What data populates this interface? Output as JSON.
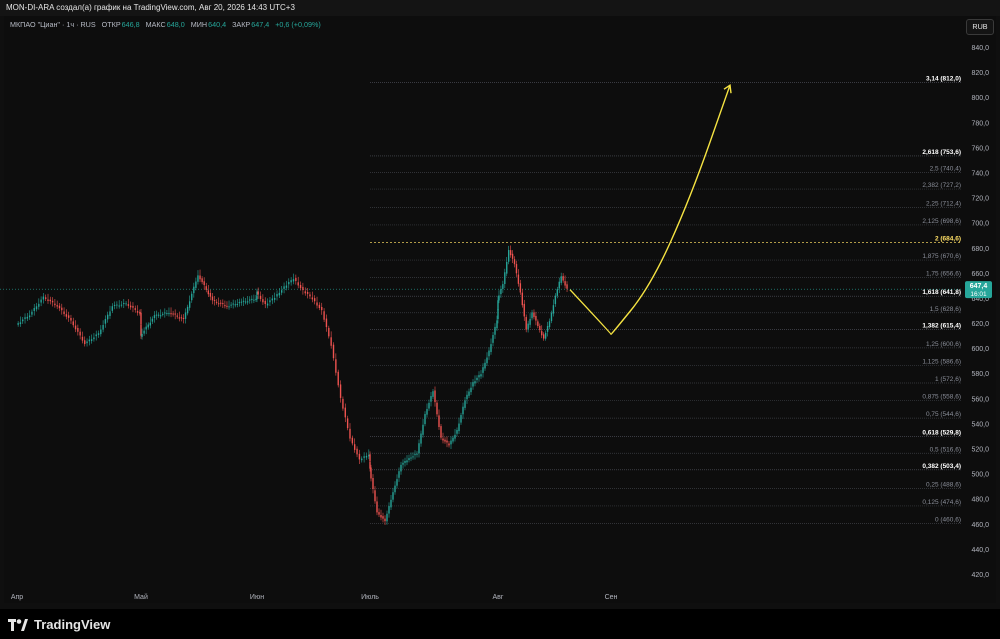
{
  "header": {
    "title": "MON-DI-ARA создал(а) график на TradingView.com, Авг 20, 2026 14:43 UTC+3"
  },
  "legend": {
    "symbol": "МКПАО \"Циан\" · 1ч · RUS",
    "open_label": "ОТКР",
    "open_value": "646,8",
    "high_label": "МАКС",
    "high_value": "648,0",
    "low_label": "МИН",
    "low_value": "640,4",
    "close_label": "ЗАКР",
    "close_value": "647,4",
    "change": "+0,6 (+0,09%)"
  },
  "currency_button": "RUB",
  "brand": {
    "name": "TradingView"
  },
  "colors": {
    "up": "#26a69a",
    "down": "#ef5350",
    "projection": "#f5e342",
    "fib_line": "#5d606b",
    "price_tag": "#26a69a"
  },
  "chart_data": {
    "type": "line",
    "chart_style": "candlestick",
    "ylim": [
      410,
      850
    ],
    "y_ticks": [
      "840,0",
      "820,0",
      "800,0",
      "780,0",
      "760,0",
      "740,0",
      "720,0",
      "700,0",
      "680,0",
      "660,0",
      "640,0",
      "620,0",
      "600,0",
      "580,0",
      "560,0",
      "540,0",
      "520,0",
      "500,0",
      "480,0",
      "460,0",
      "440,0",
      "420,0"
    ],
    "x_ticks": [
      "Апр",
      "Май",
      "Июн",
      "Июль",
      "Авг",
      "Сен"
    ],
    "price_path": [
      {
        "x": "Апр",
        "y": 619
      },
      {
        "x": "Апр",
        "y": 627
      },
      {
        "x": "Апр",
        "y": 641
      },
      {
        "x": "Апр",
        "y": 634
      },
      {
        "x": "Апр",
        "y": 622
      },
      {
        "x": "Апр",
        "y": 604
      },
      {
        "x": "Апр",
        "y": 612
      },
      {
        "x": "Апр",
        "y": 634
      },
      {
        "x": "Апр",
        "y": 636
      },
      {
        "x": "Апр",
        "y": 628
      },
      {
        "x": "Май",
        "y": 610
      },
      {
        "x": "Май",
        "y": 626
      },
      {
        "x": "Май",
        "y": 629
      },
      {
        "x": "Май",
        "y": 623
      },
      {
        "x": "Май",
        "y": 659
      },
      {
        "x": "Май",
        "y": 638
      },
      {
        "x": "Май",
        "y": 634
      },
      {
        "x": "Май",
        "y": 637
      },
      {
        "x": "Май",
        "y": 640
      },
      {
        "x": "Июн",
        "y": 645
      },
      {
        "x": "Июн",
        "y": 635
      },
      {
        "x": "Июн",
        "y": 641
      },
      {
        "x": "Июн",
        "y": 649
      },
      {
        "x": "Июн",
        "y": 656
      },
      {
        "x": "Июн",
        "y": 646
      },
      {
        "x": "Июн",
        "y": 640
      },
      {
        "x": "Июн",
        "y": 630
      },
      {
        "x": "Июн",
        "y": 603
      },
      {
        "x": "Июн",
        "y": 560
      },
      {
        "x": "Июн",
        "y": 529
      },
      {
        "x": "Июн",
        "y": 511
      },
      {
        "x": "Июн",
        "y": 516
      },
      {
        "x": "Июль",
        "y": 505
      },
      {
        "x": "Июль",
        "y": 470
      },
      {
        "x": "Июль",
        "y": 462
      },
      {
        "x": "Июль",
        "y": 486
      },
      {
        "x": "Июль",
        "y": 507
      },
      {
        "x": "Июль",
        "y": 513
      },
      {
        "x": "Июль",
        "y": 516
      },
      {
        "x": "Июль",
        "y": 548
      },
      {
        "x": "Июль",
        "y": 566
      },
      {
        "x": "Июль",
        "y": 529
      },
      {
        "x": "Июль",
        "y": 523
      },
      {
        "x": "Июль",
        "y": 535
      },
      {
        "x": "Июль",
        "y": 559
      },
      {
        "x": "Июль",
        "y": 573
      },
      {
        "x": "Июль",
        "y": 580
      },
      {
        "x": "Июль",
        "y": 598
      },
      {
        "x": "Июль",
        "y": 623
      },
      {
        "x": "Авг",
        "y": 639
      },
      {
        "x": "Авг",
        "y": 651
      },
      {
        "x": "Авг",
        "y": 679
      },
      {
        "x": "Авг",
        "y": 667
      },
      {
        "x": "Авг",
        "y": 645
      },
      {
        "x": "Авг",
        "y": 615
      },
      {
        "x": "Авг",
        "y": 629
      },
      {
        "x": "Авг",
        "y": 618
      },
      {
        "x": "Авг",
        "y": 608
      },
      {
        "x": "Авг",
        "y": 622
      },
      {
        "x": "Авг",
        "y": 642
      },
      {
        "x": "Авг",
        "y": 658
      },
      {
        "x": "Авг",
        "y": 647.4
      }
    ],
    "last_price": "647,4",
    "last_price_timer": "16:01",
    "fibonacci_levels": [
      {
        "ratio": "0",
        "price": "460,6",
        "label": "0 (460,6)",
        "bold": false
      },
      {
        "ratio": "0,125",
        "price": "474,6",
        "label": "0,125 (474,6)",
        "bold": false
      },
      {
        "ratio": "0,25",
        "price": "488,6",
        "label": "0,25 (488,6)",
        "bold": false
      },
      {
        "ratio": "0,382",
        "price": "503,4",
        "label": "0,382 (503,4)",
        "bold": true
      },
      {
        "ratio": "0,5",
        "price": "516,6",
        "label": "0,5 (516,6)",
        "bold": false
      },
      {
        "ratio": "0,618",
        "price": "529,8",
        "label": "0,618 (529,8)",
        "bold": true
      },
      {
        "ratio": "0,75",
        "price": "544,6",
        "label": "0,75 (544,6)",
        "bold": false
      },
      {
        "ratio": "0,875",
        "price": "558,6",
        "label": "0,875 (558,6)",
        "bold": false
      },
      {
        "ratio": "1",
        "price": "572,6",
        "label": "1 (572,6)",
        "bold": false
      },
      {
        "ratio": "1,125",
        "price": "586,6",
        "label": "1,125 (586,6)",
        "bold": false
      },
      {
        "ratio": "1,25",
        "price": "600,6",
        "label": "1,25 (600,6)",
        "bold": false
      },
      {
        "ratio": "1,382",
        "price": "615,4",
        "label": "1,382 (615,4)",
        "bold": true
      },
      {
        "ratio": "1,5",
        "price": "628,6",
        "label": "1,5 (628,6)",
        "bold": false
      },
      {
        "ratio": "1,618",
        "price": "641,8",
        "label": "1,618 (641,8)",
        "bold": true
      },
      {
        "ratio": "1,75",
        "price": "656,6",
        "label": "1,75 (656,6)",
        "bold": false
      },
      {
        "ratio": "1,875",
        "price": "670,6",
        "label": "1,875 (670,6)",
        "bold": false
      },
      {
        "ratio": "2",
        "price": "684,6",
        "label": "2 (684,6)",
        "bold": true,
        "highlight": true
      },
      {
        "ratio": "2,125",
        "price": "698,6",
        "label": "2,125 (698,6)",
        "bold": false
      },
      {
        "ratio": "2,25",
        "price": "712,4",
        "label": "2,25 (712,4)",
        "bold": false
      },
      {
        "ratio": "2,382",
        "price": "727,2",
        "label": "2,382 (727,2)",
        "bold": false
      },
      {
        "ratio": "2,5",
        "price": "740,4",
        "label": "2,5 (740,4)",
        "bold": false
      },
      {
        "ratio": "2,618",
        "price": "753,6",
        "label": "2,618 (753,6)",
        "bold": true
      },
      {
        "ratio": "3,14",
        "price": "812,0",
        "label": "3,14 (812,0)",
        "bold": true
      }
    ],
    "projection_arrow": [
      {
        "x": "Авг",
        "y": 647
      },
      {
        "x": "Авг",
        "y": 612
      },
      {
        "x": "Сен",
        "y": 611
      },
      {
        "x": "Сен",
        "y": 650
      },
      {
        "x": "Сен",
        "y": 720
      },
      {
        "x": "Сен",
        "y": 810
      }
    ],
    "grid": false,
    "legend_position": "top-left"
  }
}
